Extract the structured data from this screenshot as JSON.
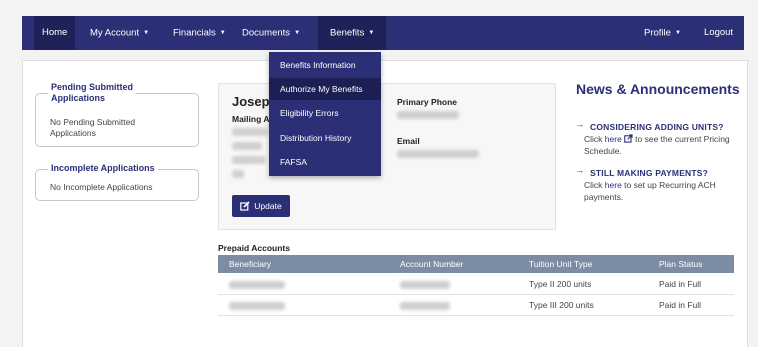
{
  "nav": {
    "home": "Home",
    "my_account": "My Account",
    "financials": "Financials",
    "documents": "Documents",
    "benefits": "Benefits",
    "profile": "Profile",
    "logout": "Logout"
  },
  "benefits_menu": [
    "Benefits Information",
    "Authorize My Benefits",
    "Eligibility Errors",
    "Distribution History",
    "FAFSA"
  ],
  "pending": {
    "legend_line1": "Pending Submitted",
    "legend_line2": "Applications",
    "text": "No Pending Submitted Applications"
  },
  "incomplete": {
    "legend": "Incomplete Applications",
    "text": "No Incomplete Applications"
  },
  "profile_card": {
    "name": "Joseph",
    "mailing_label": "Mailing A",
    "primary_phone_label": "Primary Phone",
    "email_label": "Email",
    "update_label": "Update"
  },
  "news": {
    "title": "News & Announcements",
    "item1_head": "CONSIDERING ADDING UNITS?",
    "item1_pre": "Click ",
    "item1_link": "here",
    "item1_post": " to see the current Pricing Schedule.",
    "item2_head": "STILL MAKING PAYMENTS?",
    "item2_pre": "Click ",
    "item2_link": "here",
    "item2_post": " to set up Recurring ACH payments."
  },
  "prepaid": {
    "title": "Prepaid Accounts",
    "columns": [
      "Beneficiary",
      "Account Number",
      "Tuition Unit Type",
      "Plan Status"
    ],
    "rows": [
      {
        "tuition": "Type II 200 units",
        "status": "Paid in Full"
      },
      {
        "tuition": "Type III 200 units",
        "status": "Paid in Full"
      }
    ]
  },
  "colors": {
    "brand": "#2b2f76",
    "table_header": "#7c8da3"
  },
  "icons": {
    "caret": "triangle-down",
    "edit": "pencil-square",
    "external": "external-link",
    "arrow": "right-arrow"
  }
}
